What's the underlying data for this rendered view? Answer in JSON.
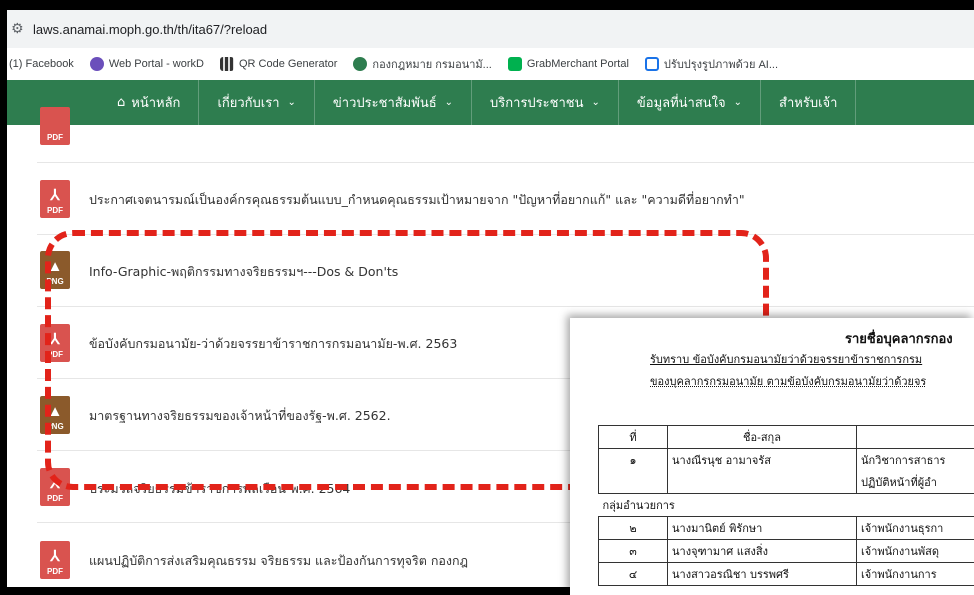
{
  "browser": {
    "url": "laws.anamai.moph.go.th/th/ita67/?reload",
    "bookmarks": [
      {
        "label": "(1) Facebook",
        "icon": "none",
        "color": ""
      },
      {
        "label": "Web Portal - workD",
        "icon": "workd-icon",
        "color": "#6b4fbb"
      },
      {
        "label": "QR Code Generator",
        "icon": "qr-icon",
        "color": "#333333"
      },
      {
        "label": "กองกฎหมาย กรมอนามั...",
        "icon": "site-icon",
        "color": "#2e7d4f"
      },
      {
        "label": "GrabMerchant Portal",
        "icon": "grab-icon",
        "color": "#00b14f"
      },
      {
        "label": "ปรับปรุงรูปภาพด้วย AI...",
        "icon": "ai-icon",
        "color": "#1a73e8"
      }
    ]
  },
  "nav": {
    "items": [
      "หน้าหลัก",
      "เกี่ยวกับเรา",
      "ข่าวประชาสัมพันธ์",
      "บริการประชาชน",
      "ข้อมูลที่น่าสนใจ",
      "สำหรับเจ้า"
    ]
  },
  "files": [
    {
      "type": "PDF",
      "title": ""
    },
    {
      "type": "PDF",
      "title": "ประกาศเจตนารมณ์เป็นองค์กรคุณธรรมต้นแบบ_กำหนดคุณธรรมเป้าหมายจาก \"ปัญหาที่อยากแก้\" และ \"ความดีที่อยากทำ\""
    },
    {
      "type": "PNG",
      "title": "Info-Graphic-พฤติกรรมทางจริยธรรมฯ---Dos & Don'ts"
    },
    {
      "type": "PDF",
      "title": "ข้อบังคับกรมอนามัย-ว่าด้วยจรรยาข้าราชการกรมอนามัย-พ.ศ. 2563"
    },
    {
      "type": "PNG",
      "title": "มาตรฐานทางจริยธรรมของเจ้าหน้าที่ของรัฐ-พ.ศ. 2562."
    },
    {
      "type": "PDF",
      "title": "ประมวลจริยธรรมข้าราชการพลเรือน-พ.ศ. 2564"
    },
    {
      "type": "PDF",
      "title": "แผนปฏิบัติการส่งเสริมคุณธรรม จริยธรรม และป้องกันการทุจริต กองกฎ"
    }
  ],
  "document": {
    "title": "รายชื่อบุคลากรกอง",
    "line1": "รับทราบ  ข้อบังคับกรมอนามัยว่าด้วยจรรยาข้าราชการกรม",
    "line2": "ของบุคลากรกรมอนามัย ตามข้อบังคับกรมอนามัยว่าด้วยจร",
    "headers": [
      "ที่",
      "ชื่อ-สกุล",
      ""
    ],
    "rows": [
      [
        "๑",
        "นางณีรนุช  อามาจรัส",
        "นักวิชาการสาธาร"
      ],
      [
        "",
        "",
        "ปฏิบัติหน้าที่ผู้อำ"
      ],
      [
        "กลุ่มอำนวยการ",
        "",
        ""
      ],
      [
        "๒",
        "นางมานิตย์  พิรักษา",
        "เจ้าพนักงานธุรกา"
      ],
      [
        "๓",
        "นางจุฑามาศ แสงสิ่ง",
        "เจ้าพนักงานพัสดุ"
      ],
      [
        "๔",
        "นางสาวอรณิชา บรรพศรี",
        "เจ้าพนักงานการ"
      ]
    ]
  }
}
